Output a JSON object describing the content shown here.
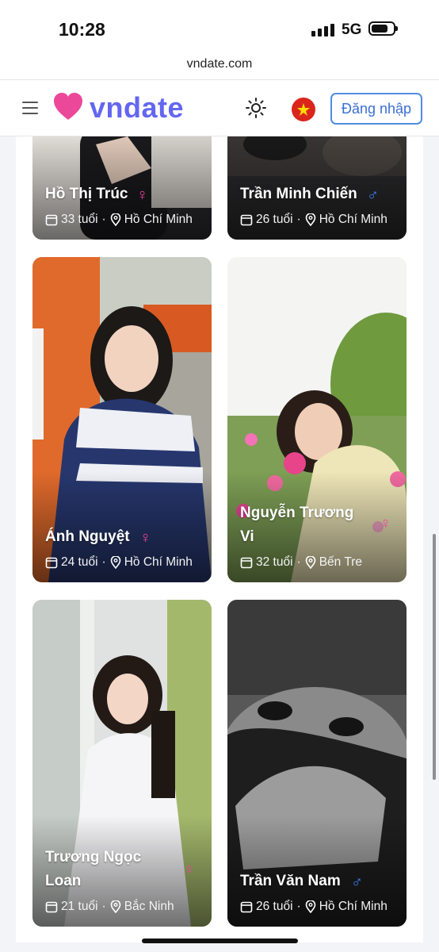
{
  "status_bar": {
    "time": "10:28",
    "network": "5G"
  },
  "browser": {
    "url": "vndate.com"
  },
  "header": {
    "brand": "vndate",
    "login_label": "Đăng nhập",
    "icons": [
      "menu-icon",
      "heart-logo-icon",
      "sun-icon",
      "vietnam-flag-icon"
    ]
  },
  "colors": {
    "brand": "#6366f1",
    "female": "#ec4899",
    "male": "#3b82f6",
    "login_border": "#4f8de0"
  },
  "profiles": [
    {
      "name": "Hồ Thị Trúc",
      "gender": "female",
      "gender_symbol": "♀",
      "age": "33 tuổi",
      "city": "Hồ Chí Minh"
    },
    {
      "name": "Trần Minh Chiến",
      "gender": "male",
      "gender_symbol": "♂",
      "age": "26 tuổi",
      "city": "Hồ Chí Minh"
    },
    {
      "name": "Ánh Nguyệt",
      "gender": "female",
      "gender_symbol": "♀",
      "age": "24 tuổi",
      "city": "Hồ Chí Minh"
    },
    {
      "name": "Nguyễn Trương Vi",
      "name_lines": [
        "Nguyễn Trương",
        "Vi"
      ],
      "gender": "female",
      "gender_symbol": "♀",
      "age": "32 tuổi",
      "city": "Bến Tre"
    },
    {
      "name": "Trương Ngọc Loan",
      "name_lines": [
        "Trương Ngọc",
        "Loan"
      ],
      "gender": "female",
      "gender_symbol": "♀",
      "age": "21 tuổi",
      "city": "Bắc Ninh"
    },
    {
      "name": "Trần Văn Nam",
      "gender": "male",
      "gender_symbol": "♂",
      "age": "26 tuổi",
      "city": "Hồ Chí Minh"
    }
  ]
}
